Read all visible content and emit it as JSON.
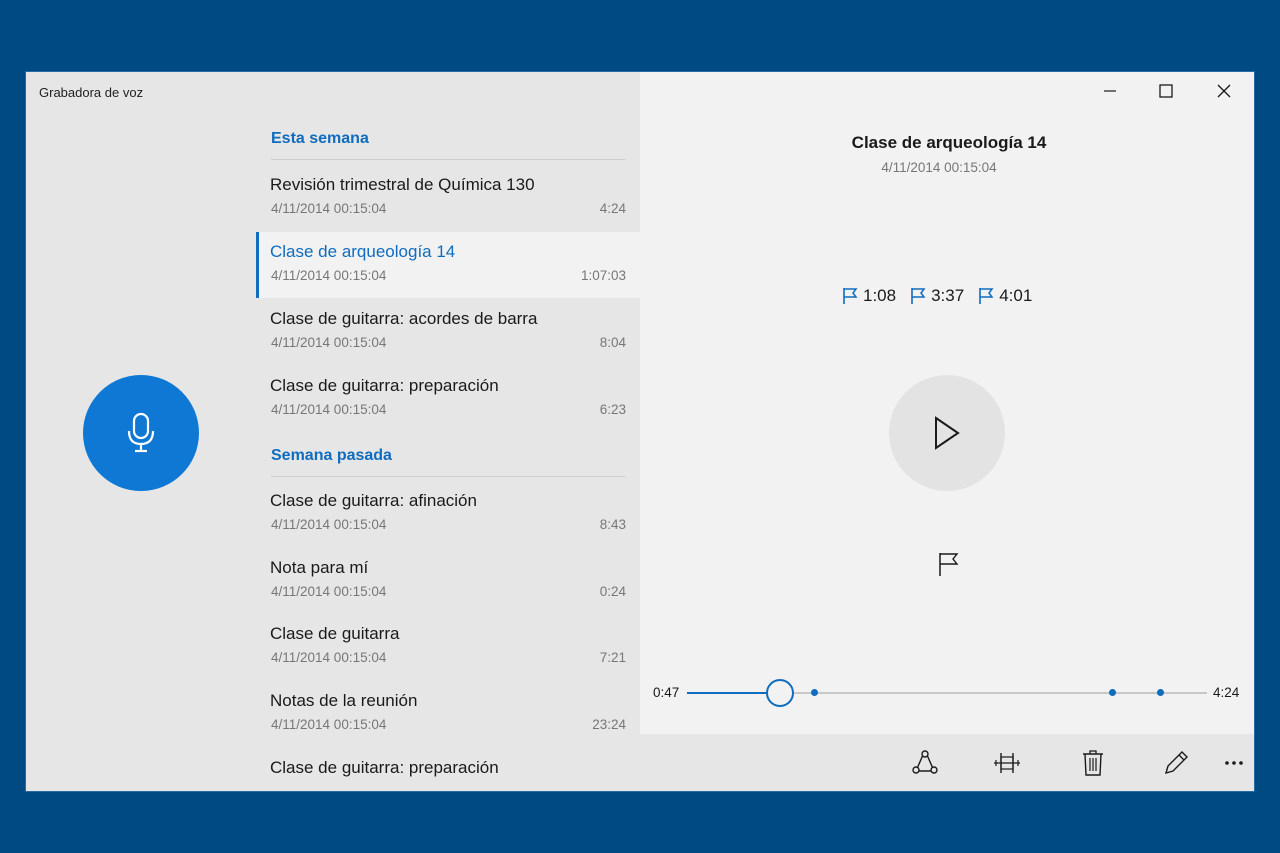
{
  "app": {
    "title": "Grabadora de voz"
  },
  "sections": [
    {
      "header": "Esta semana",
      "items": [
        {
          "title": "Revisión trimestral de Química 130",
          "date": "4/11/2014 00:15:04",
          "duration": "4:24"
        },
        {
          "title": "Clase de arqueología 14",
          "date": "4/11/2014 00:15:04",
          "duration": "1:07:03"
        },
        {
          "title": "Clase de guitarra: acordes de barra",
          "date": "4/11/2014 00:15:04",
          "duration": "8:04"
        },
        {
          "title": "Clase de guitarra: preparación",
          "date": "4/11/2014 00:15:04",
          "duration": "6:23"
        }
      ]
    },
    {
      "header": "Semana pasada",
      "items": [
        {
          "title": "Clase de guitarra: afinación",
          "date": "4/11/2014 00:15:04",
          "duration": "8:43"
        },
        {
          "title": "Nota para mí",
          "date": "4/11/2014 00:15:04",
          "duration": "0:24"
        },
        {
          "title": "Clase de guitarra",
          "date": "4/11/2014 00:15:04",
          "duration": "7:21"
        },
        {
          "title": "Notas de la reunión",
          "date": "4/11/2014 00:15:04",
          "duration": "23:24"
        },
        {
          "title": "Clase de guitarra: preparación",
          "date": "",
          "duration": ""
        }
      ]
    }
  ],
  "detail": {
    "title": "Clase de arqueología 14",
    "date": "4/11/2014 00:15:04",
    "markers": [
      "1:08",
      "3:37",
      "4:01"
    ],
    "current_time": "0:47",
    "total_time": "4:24",
    "progress_fraction": 0.178,
    "marker_fractions": [
      0.245,
      0.818,
      0.909
    ]
  },
  "colors": {
    "accent": "#0f78d4",
    "frame": "#004a84"
  }
}
